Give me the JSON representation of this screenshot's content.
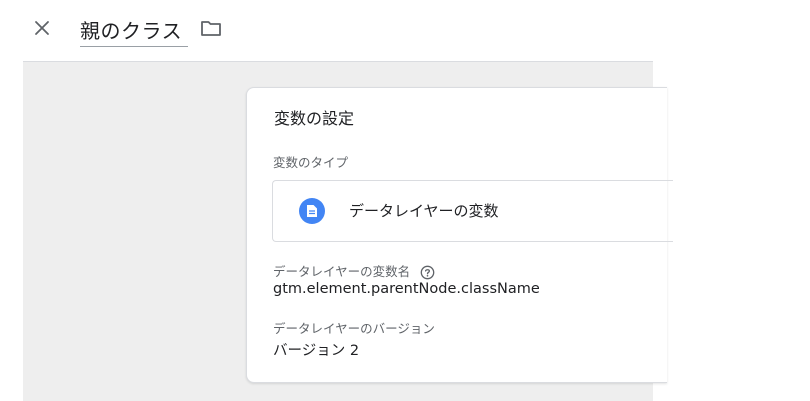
{
  "header": {
    "title": "親のクラス",
    "close_icon": "close-icon",
    "folder_icon": "folder-icon"
  },
  "card": {
    "title": "変数の設定",
    "variable_type": {
      "label": "変数のタイプ",
      "name": "データレイヤーの変数",
      "icon": "document-icon",
      "icon_color": "#4285f4"
    },
    "dlv_name": {
      "label": "データレイヤーの変数名",
      "help_icon": "help-circle-icon",
      "value": "gtm.element.parentNode.className"
    },
    "dlv_version": {
      "label": "データレイヤーのバージョン",
      "value": "バージョン 2"
    }
  }
}
